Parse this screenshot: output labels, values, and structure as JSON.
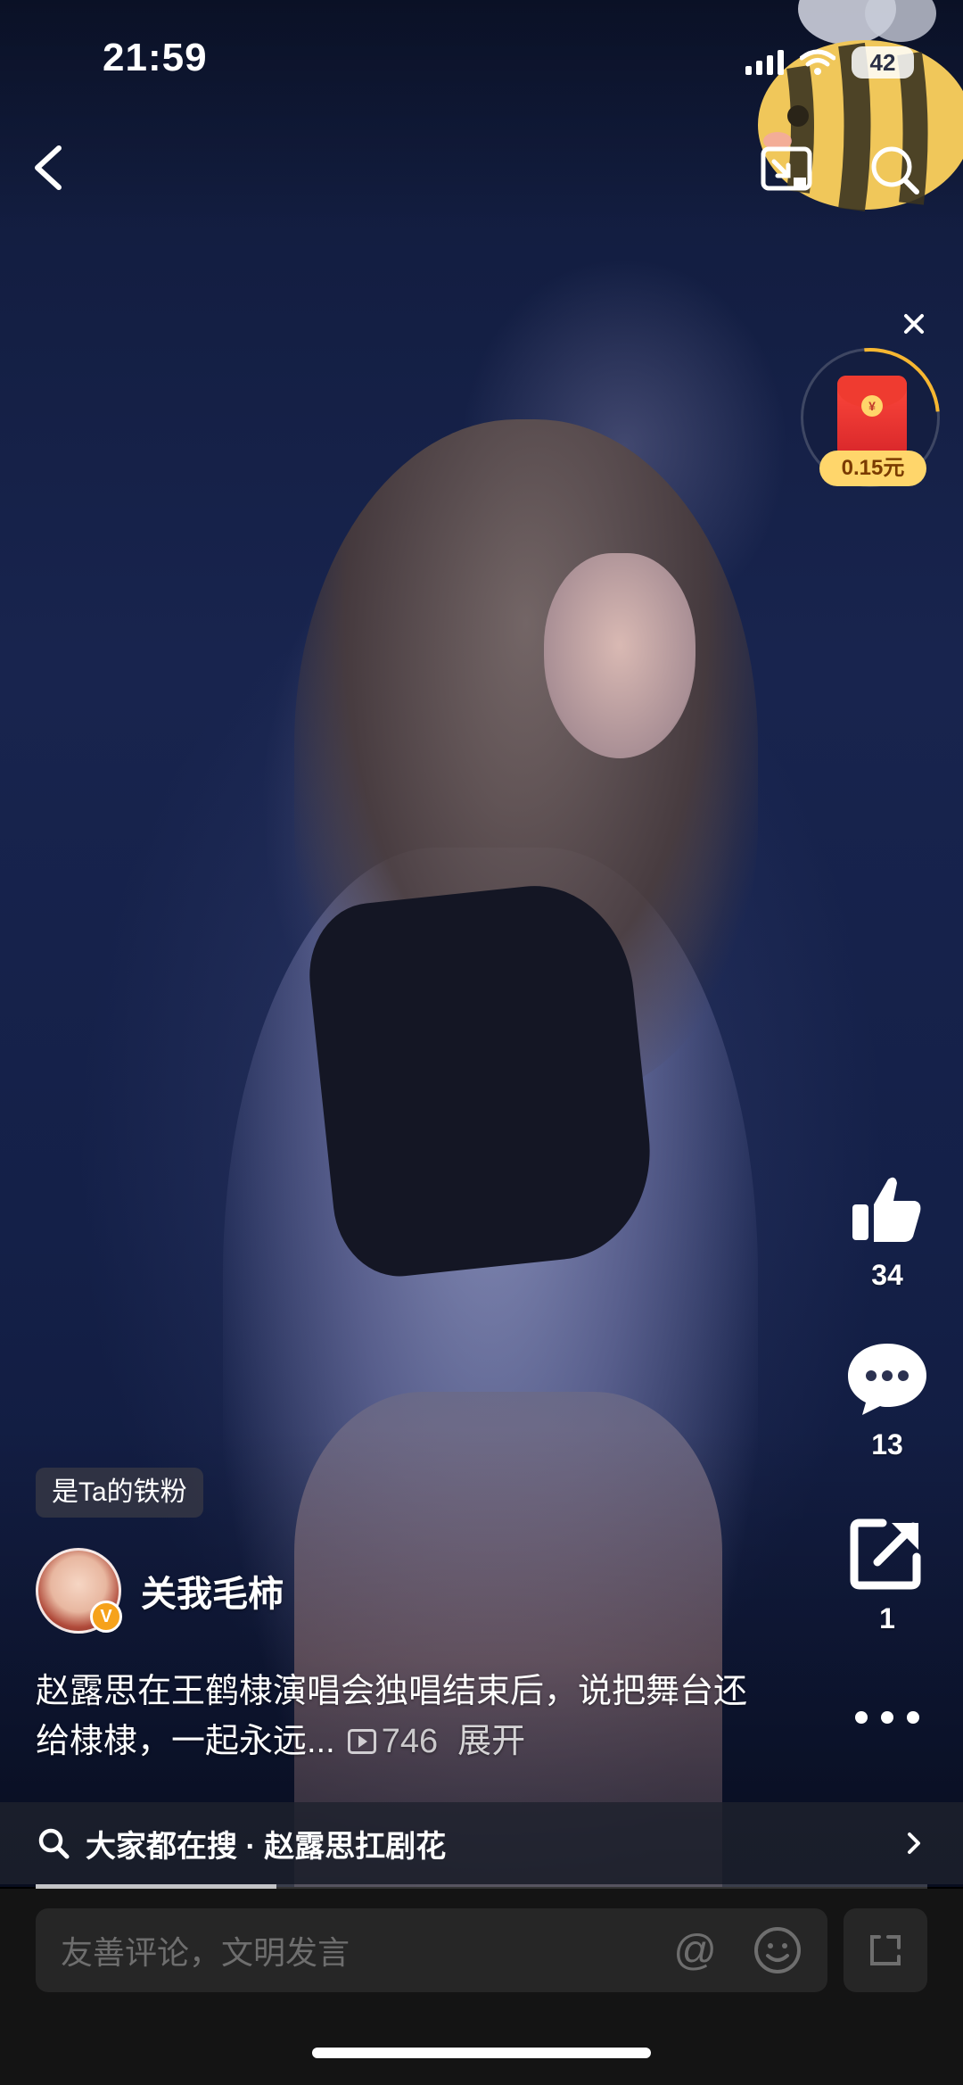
{
  "status_bar": {
    "time": "21:59",
    "battery": "42"
  },
  "red_packet": {
    "amount": "0.15元",
    "coin_symbol": "¥"
  },
  "actions": {
    "like_count": "34",
    "comment_count": "13",
    "share_count": "1"
  },
  "fan_badge": "是Ta的铁粉",
  "author": {
    "name": "关我毛柿",
    "verified_mark": "V"
  },
  "caption": {
    "text": "赵露思在王鹤棣演唱会独唱结束后，说把舞台还给棣棣，一起永远...",
    "views": "746",
    "expand_label": "展开"
  },
  "search_suggestion": {
    "text": "大家都在搜 · 赵露思扛剧花"
  },
  "playback": {
    "progress_percent": 27
  },
  "comment_bar": {
    "placeholder": "友善评论，文明发言",
    "at_symbol": "@"
  },
  "colors": {
    "accent_gold": "#f7b731",
    "red_packet": "#d8262a",
    "bottom_bar": "#141414"
  },
  "icons": [
    "back-icon",
    "cast-icon",
    "search-icon",
    "close-icon",
    "like-icon",
    "comment-icon",
    "share-icon",
    "more-icon",
    "emoji-icon",
    "fullscreen-icon",
    "play-icon"
  ]
}
